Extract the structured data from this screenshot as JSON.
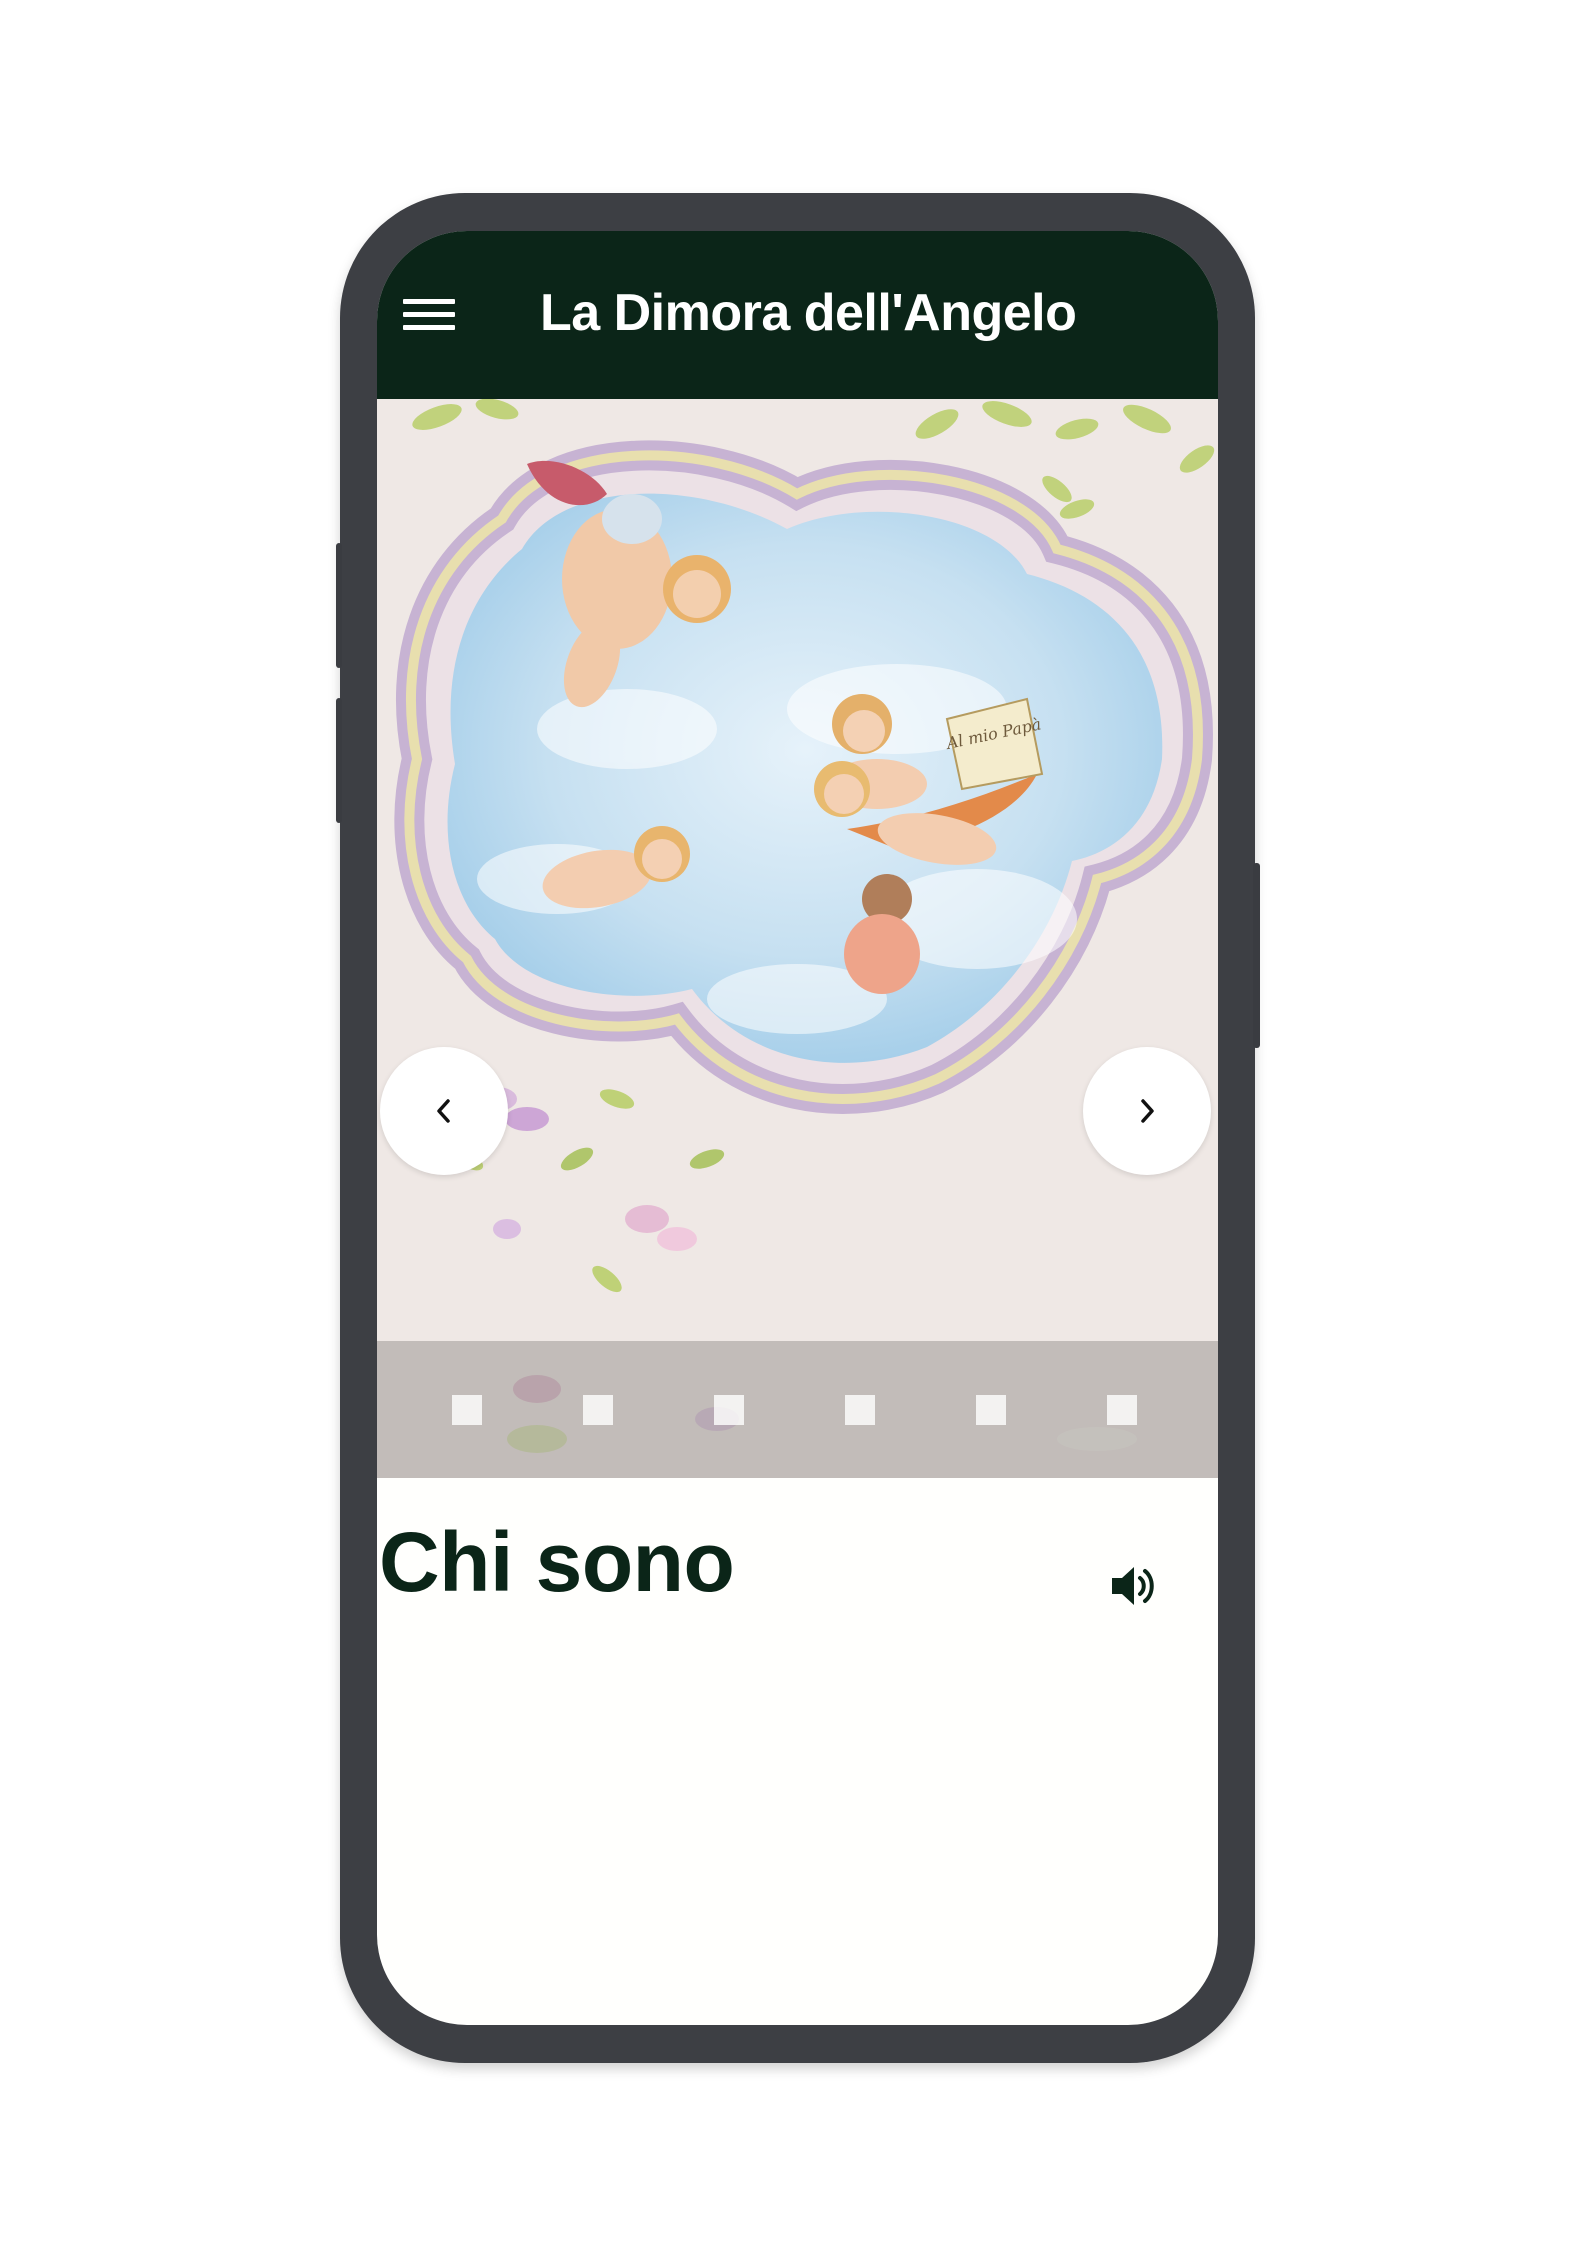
{
  "app": {
    "title": "La Dimora dell'Angelo",
    "menu_icon": "hamburger-menu-icon",
    "header_color": "#0b2518"
  },
  "carousel": {
    "image": "ceiling fresco with cherubs in a quatrefoil sky",
    "scroll_text": "Al mio Papà",
    "prev_icon": "chevron-left-icon",
    "next_icon": "chevron-right-icon",
    "slide_count": 6,
    "active_slide": 1
  },
  "content": {
    "section_title": "Chi sono",
    "audio_icon": "speaker-icon"
  }
}
